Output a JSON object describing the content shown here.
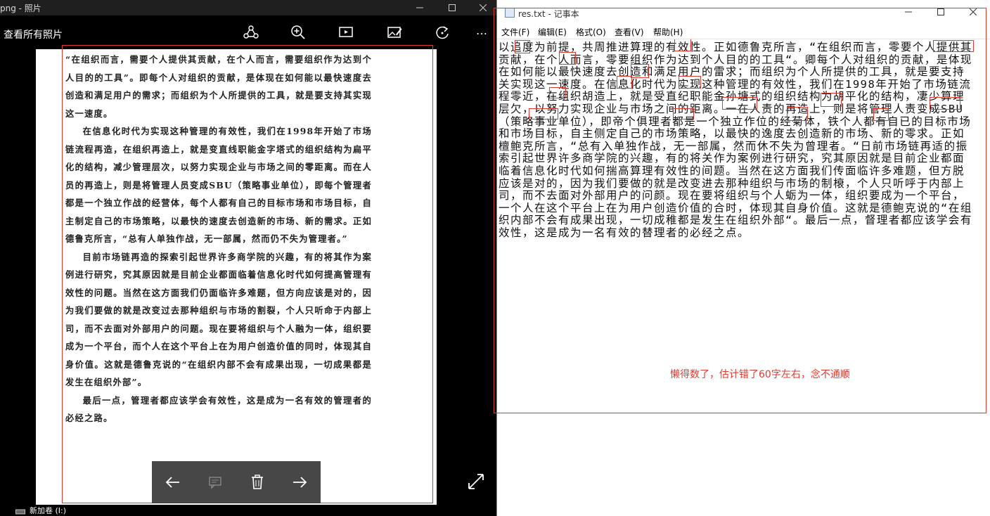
{
  "photos": {
    "window_title": "png - 照片",
    "see_all": "查看所有照片",
    "more_label": "…",
    "drive_label": "新加卷 (I:)",
    "page_paragraphs": [
      "“在组织而言，需要个人提供其贡献，在个人而言，需要组织作为达到个人目的的工具”。即每个人对组织的贡献，是体现在如何能以最快速度去创造和满足用户的需求；而组织为个人所提供的工具，就是要支持其实现这一速度。",
      "在信息化时代为实现这种管理的有效性，我们在1998年开始了市场链流程再造，在组织再造上，就是变直线职能金字塔式的组织结构为扁平化的结构，减少管理层次，以努力实现企业与市场之间的零距离。而在人员的再造上，则是将管理人员变成SBU（策略事业单位），即每个管理者都是一个独立作战的经营体，每个人都有自己的目标市场和市场目标，自主制定自己的市场策略，以最快的速度去创造新的市场、新的需求。正如德鲁克所言，“总有人单独作战，无一部属，然而仍不失为管理者。”",
      "目前市场链再造的探索引起世界许多商学院的兴趣，有的将其作为案例进行研究，究其原因就是目前企业都面临着信息化时代如何提高管理有效性的问题。当然在这方面我们仍面临许多难题，但方向应该是对的，因为我们要做的就是改变过去那种组织与市场的割裂，个人只听命于内部上司，而不去面对外部用户的问题。现在要将组织与个人融为一体，组织要成为一个平台，而个人在这个平台上在为用户创造价值的同时，体现其自身价值。这就是德鲁克说的“在组织内部不会有成果出现，一切成果都是发生在组织外部”。",
      "最后一点，管理者都应该学会有效性，这是成为一名有效的管理者的必经之路。"
    ]
  },
  "notepad": {
    "window_title": "res.txt - 记事本",
    "menus": [
      "文件(F)",
      "编辑(E)",
      "格式(O)",
      "查看(V)",
      "帮助(H)"
    ],
    "text": "以追度为前提，共周推进算理的有效性。正如德鲁克所言，“在组织而言，零要个人提供其贡献，在个人而言，零要组织作为达到个人目的的工具“。卿每个人对组织的贡献，是体现在如何能以最快速度去创造和满足用户的雷求；而组织为个人所提供的工具，就是要支持关实现这一速度。在信息化时代为实现这种管理的有效性，我们在1998年开始了市场链流程零近，在组织胡造上，就是受直纪职能金孙塘式的组织结构为胡平化的结构，凄少算理层欠，以努力实现企业与市场之间的距离。一在人责的再造上，则是将管理人责变成SBU（策略事业单位），即帝个俱理者都是一个独立作位的经菊体，铁个人都有自已的目标市场和市场目标，自主侧定自己的市场策略，以最快的逸度去创造新的市场、新的零求。正如檀鲍克所言，“总有入单独作战，无一部属，然而休不失为曾理者。“日前市场链再适的振索引起世界许多商学院的兴趣，有的将关作为案例进行研究，究其原因就是目前企业都面临着信息化时代如何揣高算理有效性的间题。当然在这方面我们传面临许多难题，但方脱应该是对的，因为我们要做的就是改变进去那种组织与市场的制榱，个人只听呼于内部上司，而不去面对外部用户的问颜。现在要将组织与个人蛎为一体，组织要成为一个平台，一个人在这个平台上在为用户创造价值的合时，体现其自身价值。这就是德鲍克说的“在组织内部不会有成果出现，一切成稚都是发生在组织外部“。最后一点，督理者都应该学会有效性，这是成为一名有效的替理者的必经之点。",
    "annotation": "懒得数了，估计错了60字左右，念不通顺"
  },
  "icons": [
    "share-icon",
    "zoom-in-icon",
    "slideshow-icon",
    "edit-image-icon",
    "rotate-icon",
    "more-icon",
    "back-arrow-icon",
    "comment-icon",
    "delete-icon",
    "forward-arrow-icon",
    "expand-icon",
    "notepad-icon",
    "drive-icon"
  ],
  "colors": {
    "annotation_red": "#e0392f",
    "photos_bg": "#000000",
    "notepad_bg": "#ffffff"
  }
}
